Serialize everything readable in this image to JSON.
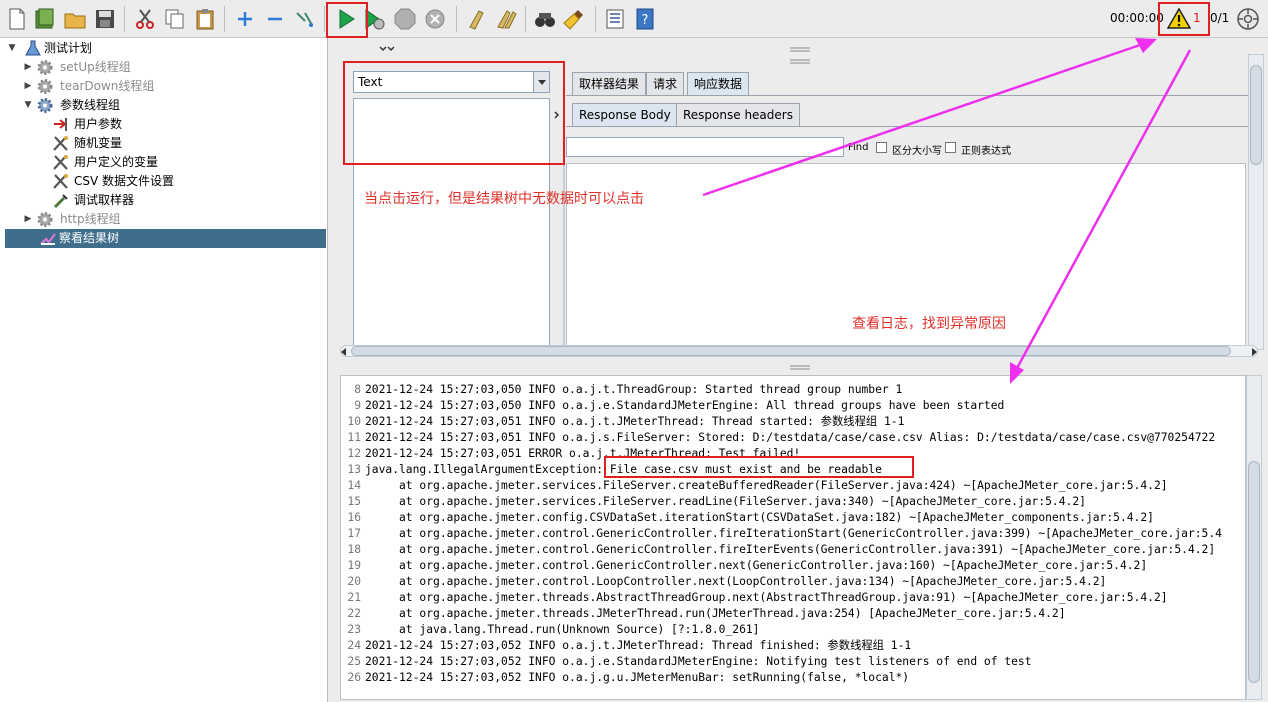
{
  "toolbar": {
    "timer": "00:00:00",
    "warning_count": "1",
    "thread_count": "0/1"
  },
  "tree": {
    "root": "测试计划",
    "setup_group": "setUp线程组",
    "teardown_group": "tearDown线程组",
    "param_group": "参数线程组",
    "user_params": "用户参数",
    "random_var": "随机变量",
    "user_defined_vars": "用户定义的变量",
    "csv_config": "CSV 数据文件设置",
    "debug_sampler": "调试取样器",
    "http_group": "http线程组",
    "result_tree": "察看结果树"
  },
  "results": {
    "renderer": "Text",
    "tabs": [
      "取样器结果",
      "请求",
      "响应数据"
    ],
    "subtabs": [
      "Response Body",
      "Response headers"
    ],
    "find_label": "Find",
    "case_sensitive": "区分大小写",
    "regex": "正则表达式"
  },
  "log": {
    "lines": [
      {
        "n": "8",
        "t": "2021-12-24 15:27:03,050 INFO o.a.j.t.ThreadGroup: Started thread group number 1"
      },
      {
        "n": "9",
        "t": "2021-12-24 15:27:03,050 INFO o.a.j.e.StandardJMeterEngine: All thread groups have been started"
      },
      {
        "n": "10",
        "t": "2021-12-24 15:27:03,051 INFO o.a.j.t.JMeterThread: Thread started: 参数线程组 1-1"
      },
      {
        "n": "11",
        "t": "2021-12-24 15:27:03,051 INFO o.a.j.s.FileServer: Stored: D:/testdata/case/case.csv Alias: D:/testdata/case/case.csv@770254722"
      },
      {
        "n": "12",
        "t": "2021-12-24 15:27:03,051 ERROR o.a.j.t.JMeterThread: Test failed!"
      },
      {
        "n": "13",
        "t": "java.lang.IllegalArgumentException: File case.csv must exist and be readable"
      },
      {
        "n": "14",
        "t": "     at org.apache.jmeter.services.FileServer.createBufferedReader(FileServer.java:424) ~[ApacheJMeter_core.jar:5.4.2]"
      },
      {
        "n": "15",
        "t": "     at org.apache.jmeter.services.FileServer.readLine(FileServer.java:340) ~[ApacheJMeter_core.jar:5.4.2]"
      },
      {
        "n": "16",
        "t": "     at org.apache.jmeter.config.CSVDataSet.iterationStart(CSVDataSet.java:182) ~[ApacheJMeter_components.jar:5.4.2]"
      },
      {
        "n": "17",
        "t": "     at org.apache.jmeter.control.GenericController.fireIterationStart(GenericController.java:399) ~[ApacheJMeter_core.jar:5.4"
      },
      {
        "n": "18",
        "t": "     at org.apache.jmeter.control.GenericController.fireIterEvents(GenericController.java:391) ~[ApacheJMeter_core.jar:5.4.2]"
      },
      {
        "n": "19",
        "t": "     at org.apache.jmeter.control.GenericController.next(GenericController.java:160) ~[ApacheJMeter_core.jar:5.4.2]"
      },
      {
        "n": "20",
        "t": "     at org.apache.jmeter.control.LoopController.next(LoopController.java:134) ~[ApacheJMeter_core.jar:5.4.2]"
      },
      {
        "n": "21",
        "t": "     at org.apache.jmeter.threads.AbstractThreadGroup.next(AbstractThreadGroup.java:91) ~[ApacheJMeter_core.jar:5.4.2]"
      },
      {
        "n": "22",
        "t": "     at org.apache.jmeter.threads.JMeterThread.run(JMeterThread.java:254) [ApacheJMeter_core.jar:5.4.2]"
      },
      {
        "n": "23",
        "t": "     at java.lang.Thread.run(Unknown Source) [?:1.8.0_261]"
      },
      {
        "n": "24",
        "t": "2021-12-24 15:27:03,052 INFO o.a.j.t.JMeterThread: Thread finished: 参数线程组 1-1"
      },
      {
        "n": "25",
        "t": "2021-12-24 15:27:03,052 INFO o.a.j.e.StandardJMeterEngine: Notifying test listeners of end of test"
      },
      {
        "n": "26",
        "t": "2021-12-24 15:27:03,052 INFO o.a.j.g.u.JMeterMenuBar: setRunning(false, *local*)"
      }
    ]
  },
  "annotations": {
    "click_note": "当点击运行，但是结果树中无数据时可以点击",
    "log_note": "查看日志，找到异常原因"
  }
}
